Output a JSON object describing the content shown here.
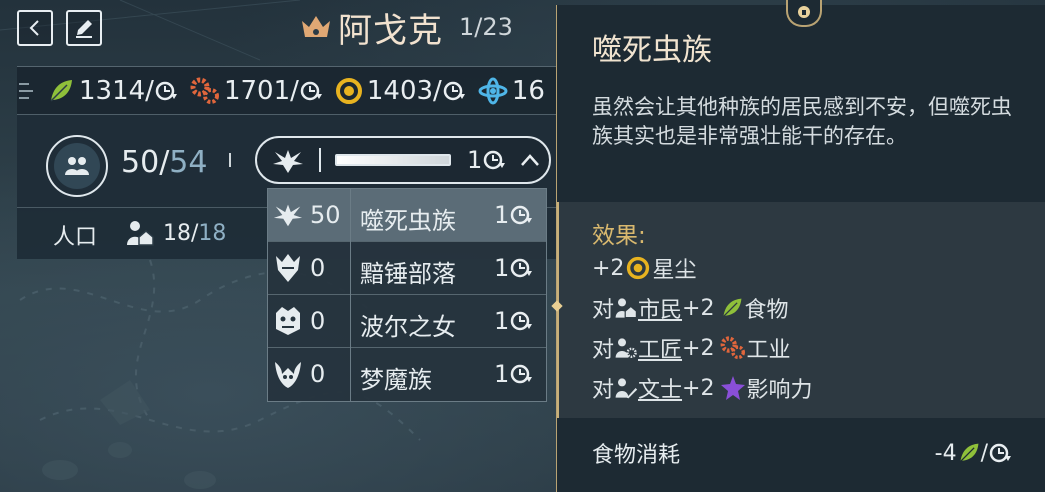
{
  "topbar": {
    "back_icon": "chevron-left-icon",
    "rename_icon": "pencil-icon",
    "city_name": "阿戈克",
    "city_index": "1/23",
    "crown_color": "#e0a874"
  },
  "resources": [
    {
      "icon": "leaf-icon",
      "value": "1314/",
      "color": "#8fc03a"
    },
    {
      "icon": "gears-icon",
      "value": "1701/",
      "color": "#e0663c"
    },
    {
      "icon": "dust-ring-icon",
      "value": "1403/",
      "color": "#e8b320"
    },
    {
      "icon": "science-icon",
      "value": "16",
      "color": "#4fb6e8"
    }
  ],
  "city": {
    "population": "50",
    "population_max": "54",
    "population_label": "人口",
    "workers": "18",
    "workers_max": "18"
  },
  "selector": {
    "value": "1",
    "fill_fraction": 1.0
  },
  "dropdown": [
    {
      "icon": "necrophage-icon",
      "count": "50",
      "name": "噬死虫族",
      "growth": "1",
      "selected": true
    },
    {
      "icon": "broken-lords-icon",
      "count": "0",
      "name": "黯锤部落",
      "growth": "1",
      "selected": false
    },
    {
      "icon": "vaulters-icon",
      "count": "0",
      "name": "波尔之女",
      "growth": "1",
      "selected": false
    },
    {
      "icon": "drakken-icon",
      "count": "0",
      "name": "梦魔族",
      "growth": "1",
      "selected": false
    }
  ],
  "tooltip": {
    "title": "噬死虫族",
    "description": "虽然会让其他种族的居民感到不安，但噬死虫族其实也是非常强壮能干的存在。",
    "effects_title": "效果:",
    "effects": {
      "dust": {
        "amount": "+2",
        "resource": "星尘"
      },
      "citizen": {
        "prefix": "对",
        "role": "市民",
        "amount": "+2",
        "resource": "食物"
      },
      "artisan": {
        "prefix": "对",
        "role": "工匠",
        "amount": "+2",
        "resource": "工业"
      },
      "scholar": {
        "prefix": "对",
        "role": "文士",
        "amount": "+2",
        "resource": "影响力"
      }
    },
    "footer_label": "食物消耗",
    "footer_value": "-4",
    "footer_slash": "/"
  },
  "colors": {
    "food": "#8fc03a",
    "industry": "#e0663c",
    "dust": "#e8b320",
    "influence": "#8a4fd8",
    "science": "#4fb6e8",
    "gold_border": "#b9a373"
  }
}
